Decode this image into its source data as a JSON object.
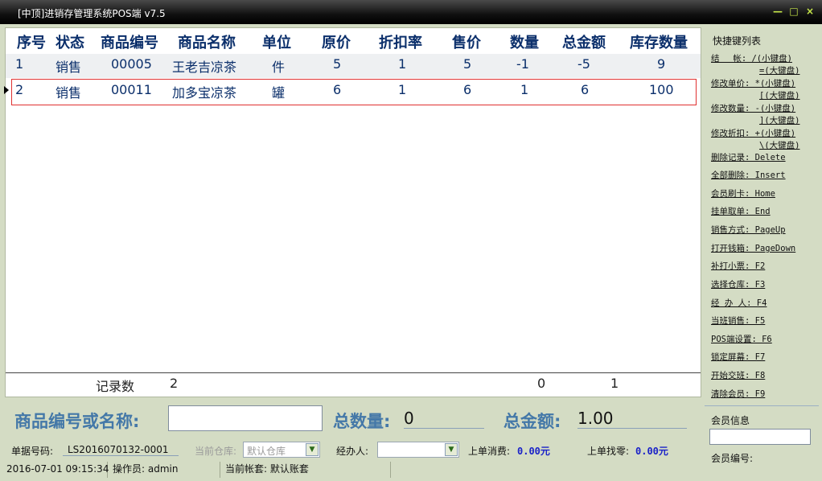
{
  "window": {
    "title": "[中顶]进销存管理系统POS端 v7.5",
    "controls": {
      "minimize": "—",
      "maximize": "□",
      "close": "×"
    }
  },
  "grid": {
    "columns": [
      "序号",
      "状态",
      "商品编号",
      "商品名称",
      "单位",
      "原价",
      "折扣率",
      "售价",
      "数量",
      "总金额",
      "库存数量"
    ],
    "rows": [
      {
        "no": "1",
        "status": "销售",
        "code": "00005",
        "name": "王老吉凉茶",
        "unit": "件",
        "orig": "5",
        "discount": "1",
        "price": "5",
        "qty": "-1",
        "total": "-5",
        "stock": "9"
      },
      {
        "no": "2",
        "status": "销售",
        "code": "00011",
        "name": "加多宝凉茶",
        "unit": "罐",
        "orig": "6",
        "discount": "1",
        "price": "6",
        "qty": "1",
        "total": "6",
        "stock": "100"
      }
    ],
    "footer": {
      "label": "记录数",
      "count": "2",
      "qty_sum": "0",
      "total_sum": "1"
    }
  },
  "shortcuts": {
    "title": "快捷键列表",
    "items": [
      {
        "label": "结　 帐: /(小键盘)"
      },
      {
        "label": "=(大键盘)"
      },
      {
        "label": "修改单价: *(小键盘)"
      },
      {
        "label": "[(大键盘)"
      },
      {
        "label": "修改数量: -(小键盘)"
      },
      {
        "label": "](大键盘)"
      },
      {
        "label": "修改折扣: +(小键盘)"
      },
      {
        "label": "\\(大键盘)"
      },
      {
        "label": "删除记录: Delete"
      },
      {
        "label": "全部删除: Insert"
      },
      {
        "label": "会员刷卡: Home"
      },
      {
        "label": "挂单取单: End"
      },
      {
        "label": "销售方式: PageUp"
      },
      {
        "label": "打开钱箱: PageDown"
      },
      {
        "label": "补打小票: F2"
      },
      {
        "label": "选择仓库: F3"
      },
      {
        "label": "经 办 人: F4"
      },
      {
        "label": "当班销售: F5"
      },
      {
        "label": "POS端设置: F6"
      },
      {
        "label": "锁定屏幕: F7"
      },
      {
        "label": "开始交班: F8"
      },
      {
        "label": "清除会员: F9"
      }
    ]
  },
  "input_bar": {
    "code_label": "商品编号或名称:",
    "code_value": "",
    "qty_label": "总数量:",
    "qty_value": "0",
    "amount_label": "总金额:",
    "amount_value": "1.00"
  },
  "member": {
    "title": "会员信息",
    "no_label": "会员编号:"
  },
  "info": {
    "bill_label": "单据号码:",
    "bill_no": "LS2016070132-0001",
    "warehouse_label": "当前仓库:",
    "warehouse_value": "默认仓库",
    "handler_label": "经办人:",
    "handler_value": "",
    "last_consume_label": "上单消费:",
    "last_consume_value": "0.00元",
    "last_change_label": "上单找零:",
    "last_change_value": "0.00元"
  },
  "status": {
    "datetime": "2016-07-01 09:15:34",
    "operator": "操作员: admin",
    "account": "当前帐套: 默认账套"
  },
  "colors": {
    "title_bg": "#000000",
    "header_text": "#0b2f6b",
    "accent_blue": "#4478a8",
    "money_blue": "#1a22c8",
    "selection_red": "#e03030",
    "panel_bg": "#d4dcc4"
  }
}
